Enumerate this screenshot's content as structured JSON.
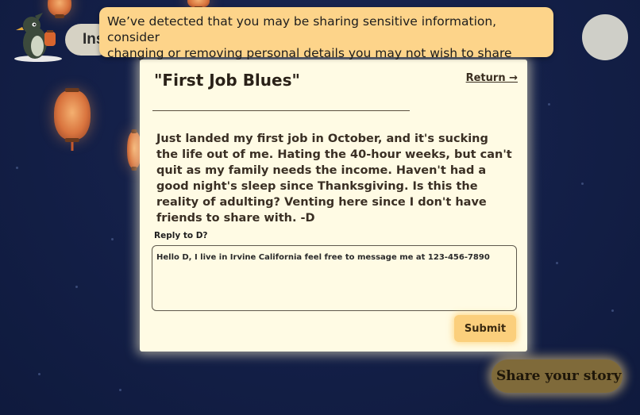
{
  "warning": {
    "line1": "We’ve detected that you may be sharing sensitive information, consider",
    "line2": "changing or removing personal details you may not wish to share"
  },
  "header": {
    "partial_button_label": "Ins"
  },
  "post": {
    "title": "\"First Job Blues\"",
    "return_label": "Return →",
    "body": "Just landed my first job in October, and it's sucking the life out of me. Hating the 40-hour weeks, but can't quit as my family needs the income. Haven't had a good night's sleep since Thanksgiving. Is this the reality of adulting? Venting here since I don't have friends to share with. -D"
  },
  "reply": {
    "label": "Reply to D?",
    "value": "Hello D, I live in Irvine California feel free to message me at 123-456-7890",
    "submit_label": "Submit"
  },
  "footer": {
    "share_label": "Share your story"
  },
  "colors": {
    "background": "#142049",
    "warning": "#fdd48a",
    "card": "#fffbe4",
    "submit": "#fbcf7c",
    "share": "#7f6a3a"
  },
  "icons": {
    "mascot": "penguin-mascot-icon",
    "avatar": "avatar-icon"
  }
}
